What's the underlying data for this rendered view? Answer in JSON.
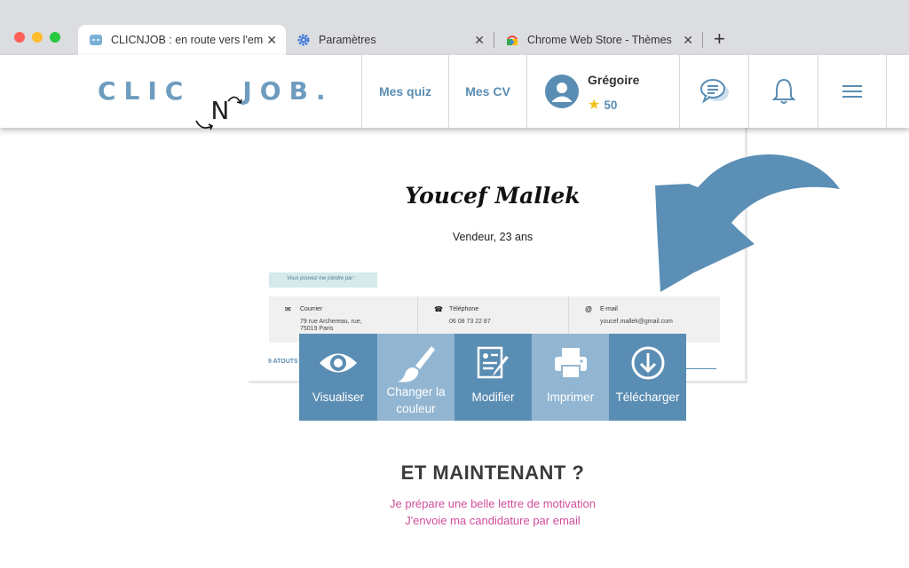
{
  "browser": {
    "tabs": [
      {
        "title": "CLICNJOB : en route vers l'ema",
        "active": true
      },
      {
        "title": "Paramètres",
        "active": false
      },
      {
        "title": "Chrome Web Store - Thèmes",
        "active": false
      }
    ],
    "close_glyph": "✕",
    "new_tab_glyph": "+"
  },
  "header": {
    "logo_left": "CLIC",
    "logo_mid": "N",
    "logo_right": "JOB.",
    "nav": [
      "Mes quiz",
      "Mes CV"
    ],
    "user": {
      "name": "Grégoire",
      "points": "50"
    },
    "icons": [
      "chat-icon",
      "bell-icon",
      "menu-icon"
    ]
  },
  "cv": {
    "name": "Youcef Mallek",
    "subtitle": "Vendeur, 23 ans",
    "contact_tag": "Vous pouvez me joindre par :",
    "contacts": [
      {
        "label": "Courrier",
        "value_line1": "79 rue Archereau, rue,",
        "value_line2": "75019 Paris"
      },
      {
        "label": "Téléphone",
        "value_line1": "06 08 73 22 87",
        "value_line2": ""
      },
      {
        "label": "E-mail",
        "value_line1": "youcef.mallek@gmail.com",
        "value_line2": ""
      }
    ],
    "section_peek": "9 ATOUTS"
  },
  "actions": [
    {
      "label": "Visualiser",
      "label2": "",
      "color": "#5a8db3"
    },
    {
      "label": "Changer la",
      "label2": "couleur",
      "color": "#92b6d2"
    },
    {
      "label": "Modifier",
      "label2": "",
      "color": "#5a8db3"
    },
    {
      "label": "Imprimer",
      "label2": "",
      "color": "#92b6d2"
    },
    {
      "label": "Télécharger",
      "label2": "",
      "color": "#5a8db3"
    }
  ],
  "next": {
    "title": "ET MAINTENANT ?",
    "line1": "Je prépare une belle lettre de motivation",
    "line2": "J'envoie ma candidature par email"
  },
  "colors": {
    "accent": "#5a8db3",
    "accent_light": "#92b6d2",
    "pink": "#d14d9a",
    "arrow": "#5b8fb6"
  }
}
